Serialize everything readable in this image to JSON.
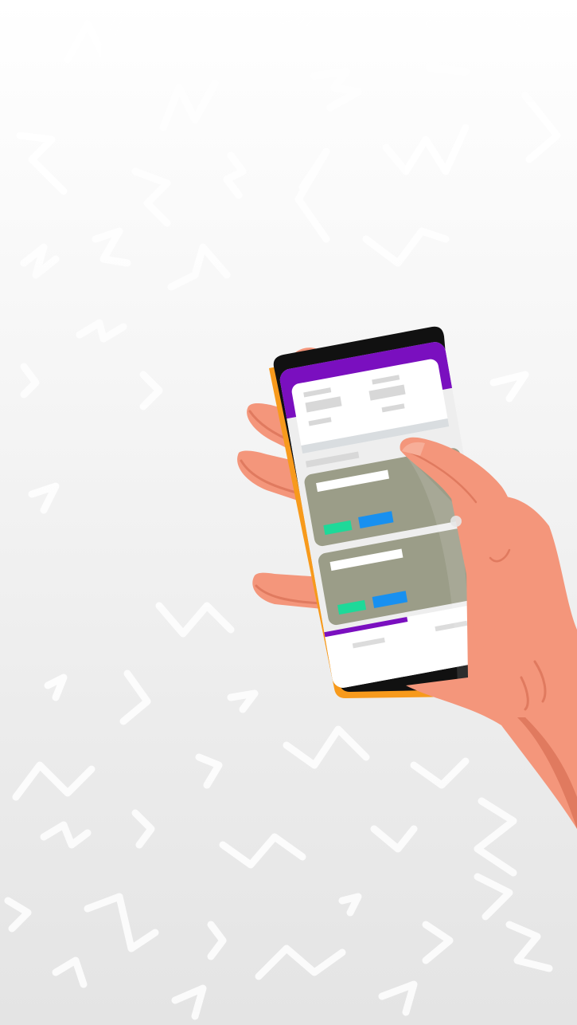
{
  "illustration": {
    "subject": "hand-holding-phone",
    "colors": {
      "background_top": "#ffffff",
      "background_bottom": "#e4e4e4",
      "pattern": "#ffffff",
      "skin": "#f4967b",
      "skin_shadow": "#e07a5f",
      "phone_case": "#f79a1c",
      "phone_frame": "#111111",
      "header": "#7a0fbf",
      "card": "#9b9d88",
      "button_green": "#1ed999",
      "button_blue": "#1890f0",
      "placeholder": "#d8d8d8"
    }
  }
}
